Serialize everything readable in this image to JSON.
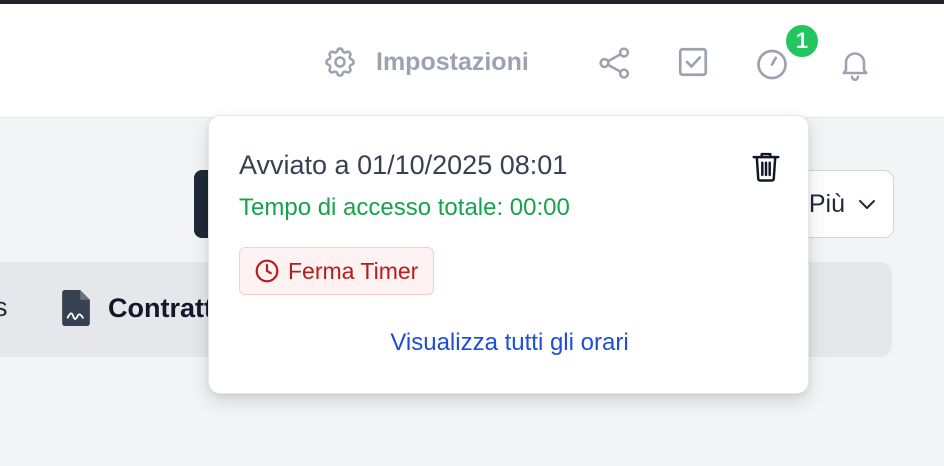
{
  "header": {
    "settings_label": "Impostazioni",
    "notification_badge": "1",
    "icons": [
      "gear-icon",
      "share-icon",
      "checkbox-icon",
      "timer-icon",
      "bell-icon"
    ]
  },
  "background": {
    "more_button_label": "Più",
    "tab_partial_label": "s",
    "tab_contracts_label": "Contratt"
  },
  "popover": {
    "started_text": "Avviato a 01/10/2025 08:01",
    "total_text": "Tempo di accesso totale: 00:00",
    "stop_label": "Ferma Timer",
    "view_all_label": "Visualizza tutti gli orari"
  },
  "colors": {
    "accent_green": "#16a34a",
    "badge_green": "#22c55e",
    "danger_red": "#b91c1c",
    "link_blue": "#1d4ed8"
  }
}
